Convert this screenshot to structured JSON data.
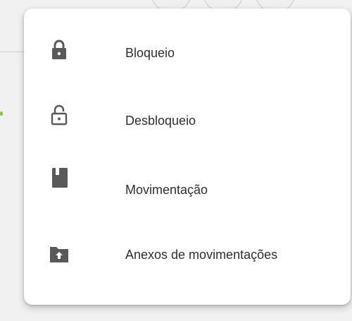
{
  "menu": {
    "items": [
      {
        "label": "Bloqueio",
        "icon": "lock-icon"
      },
      {
        "label": "Desbloqueio",
        "icon": "lock-open-icon"
      },
      {
        "label": "Movimentação",
        "icon": "book-icon"
      },
      {
        "label": "Anexos de movimentações",
        "icon": "folder-upload-icon"
      }
    ]
  },
  "colors": {
    "menu_background": "#ffffff",
    "icon": "#595959",
    "text": "#2e2e2e",
    "backdrop": "#f1f1f1"
  }
}
